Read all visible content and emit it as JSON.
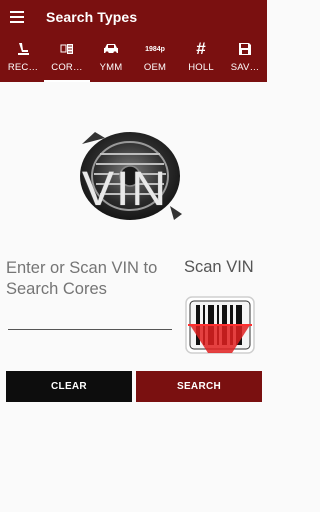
{
  "appbar": {
    "title": "Search Types",
    "menu_icon": "hamburger-menu-icon"
  },
  "tabs": [
    {
      "label": "REC…",
      "icon": "seat-icon"
    },
    {
      "label": "COR…",
      "icon": "cores-icon"
    },
    {
      "label": "YMM",
      "icon": "car-icon"
    },
    {
      "label": "OEM",
      "icon": "oem-number-icon",
      "icon_text": "1984p"
    },
    {
      "label": "HOLL",
      "icon": "hash-icon",
      "icon_text": "#"
    },
    {
      "label": "SAV…",
      "icon": "save-icon"
    }
  ],
  "active_tab": "COR…",
  "hero": {
    "overlay_text": "VIN",
    "image": "alternator-image"
  },
  "vin_input": {
    "placeholder": "Enter or Scan VIN to Search Cores",
    "value": ""
  },
  "scan": {
    "label": "Scan VIN",
    "icon": "barcode-scanner-icon"
  },
  "buttons": {
    "clear": "CLEAR",
    "search": "SEARCH"
  },
  "colors": {
    "primary": "#7a1010",
    "clear_button": "#0d0d0d",
    "background": "#fafafa"
  }
}
